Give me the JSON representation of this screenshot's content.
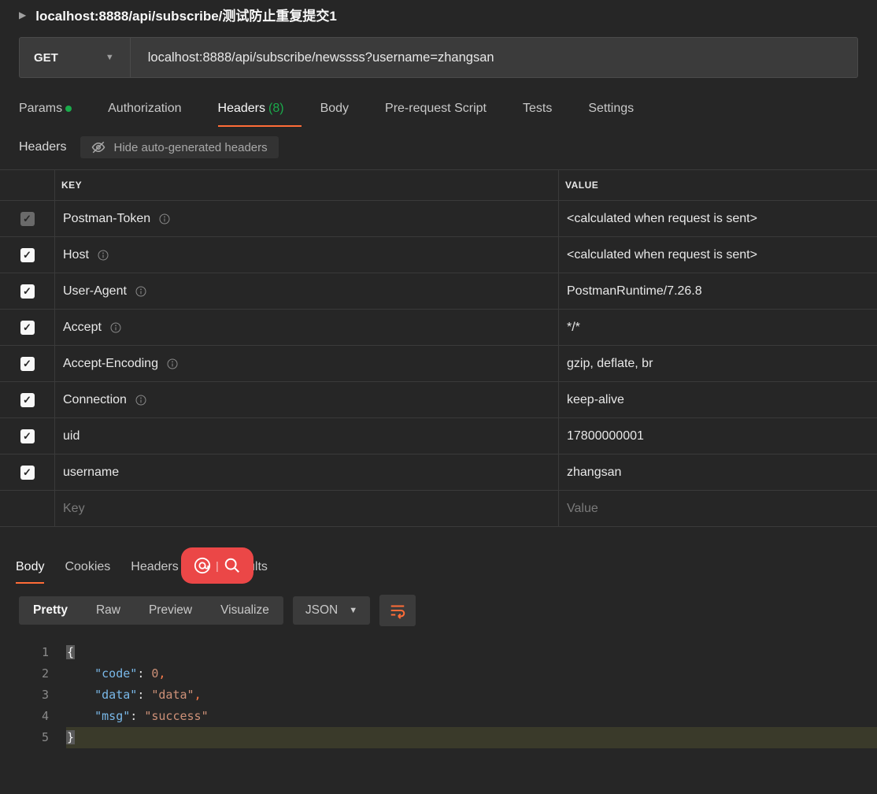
{
  "request_name": "localhost:8888/api/subscribe/测试防止重复提交1",
  "method": "GET",
  "url": "localhost:8888/api/subscribe/newssss?username=zhangsan",
  "req_tabs": {
    "params": "Params",
    "auth": "Authorization",
    "headers": "Headers",
    "headers_count": "(8)",
    "body": "Body",
    "prerequest": "Pre-request Script",
    "tests": "Tests",
    "settings": "Settings"
  },
  "headers_sub": {
    "label": "Headers",
    "hide": "Hide auto-generated headers"
  },
  "table": {
    "head_key": "KEY",
    "head_value": "VALUE",
    "new_key_placeholder": "Key",
    "new_value_placeholder": "Value",
    "rows": [
      {
        "key": "Postman-Token",
        "value": "<calculated when request is sent>",
        "info": true,
        "disabled": true
      },
      {
        "key": "Host",
        "value": "<calculated when request is sent>",
        "info": true,
        "disabled": false
      },
      {
        "key": "User-Agent",
        "value": "PostmanRuntime/7.26.8",
        "info": true,
        "disabled": false
      },
      {
        "key": "Accept",
        "value": "*/*",
        "info": true,
        "disabled": false
      },
      {
        "key": "Accept-Encoding",
        "value": "gzip, deflate, br",
        "info": true,
        "disabled": false
      },
      {
        "key": "Connection",
        "value": "keep-alive",
        "info": true,
        "disabled": false
      },
      {
        "key": "uid",
        "value": "17800000001",
        "info": false,
        "disabled": false
      },
      {
        "key": "username",
        "value": "zhangsan",
        "info": false,
        "disabled": false
      }
    ]
  },
  "resp_tabs": {
    "body": "Body",
    "cookies": "Cookies",
    "headers": "Headers",
    "test_results": "Test Results"
  },
  "body_toolbar": {
    "pretty": "Pretty",
    "raw": "Raw",
    "preview": "Preview",
    "visualize": "Visualize",
    "format": "JSON"
  },
  "response_json": {
    "code": 0,
    "data": "data",
    "msg": "success"
  },
  "response_lines": {
    "l1": "{",
    "l2_key": "\"code\"",
    "l2_val": "0",
    "l3_key": "\"data\"",
    "l3_val": "\"data\"",
    "l4_key": "\"msg\"",
    "l4_val": "\"success\"",
    "l5": "}"
  }
}
